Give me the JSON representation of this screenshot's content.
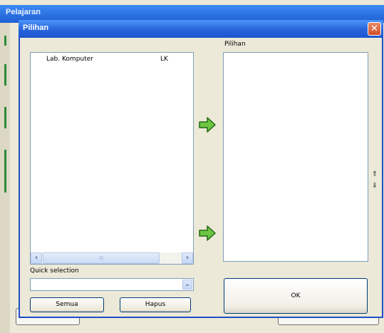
{
  "background_window": {
    "title": "Pelajaran"
  },
  "dialog": {
    "title": "Pilihan",
    "close_glyph": "✕"
  },
  "left_list": {
    "items": [
      {
        "name": "Lab. Komputer",
        "code": "LK"
      }
    ],
    "scroll_left": "‹",
    "scroll_right": "›",
    "scroll_grip": "III"
  },
  "right_list": {
    "label": "Pilihan"
  },
  "move_up_glyph": "⇑",
  "move_down_glyph": "⇓",
  "quick_selection": {
    "label": "Quick selection",
    "value": "",
    "dropdown_glyph": "⌄"
  },
  "buttons": {
    "all": "Semua",
    "delete": "Hapus",
    "ok": "OK"
  },
  "icons": {
    "arrow_color": "#6cc644",
    "arrow_outline": "#1f6a12"
  }
}
